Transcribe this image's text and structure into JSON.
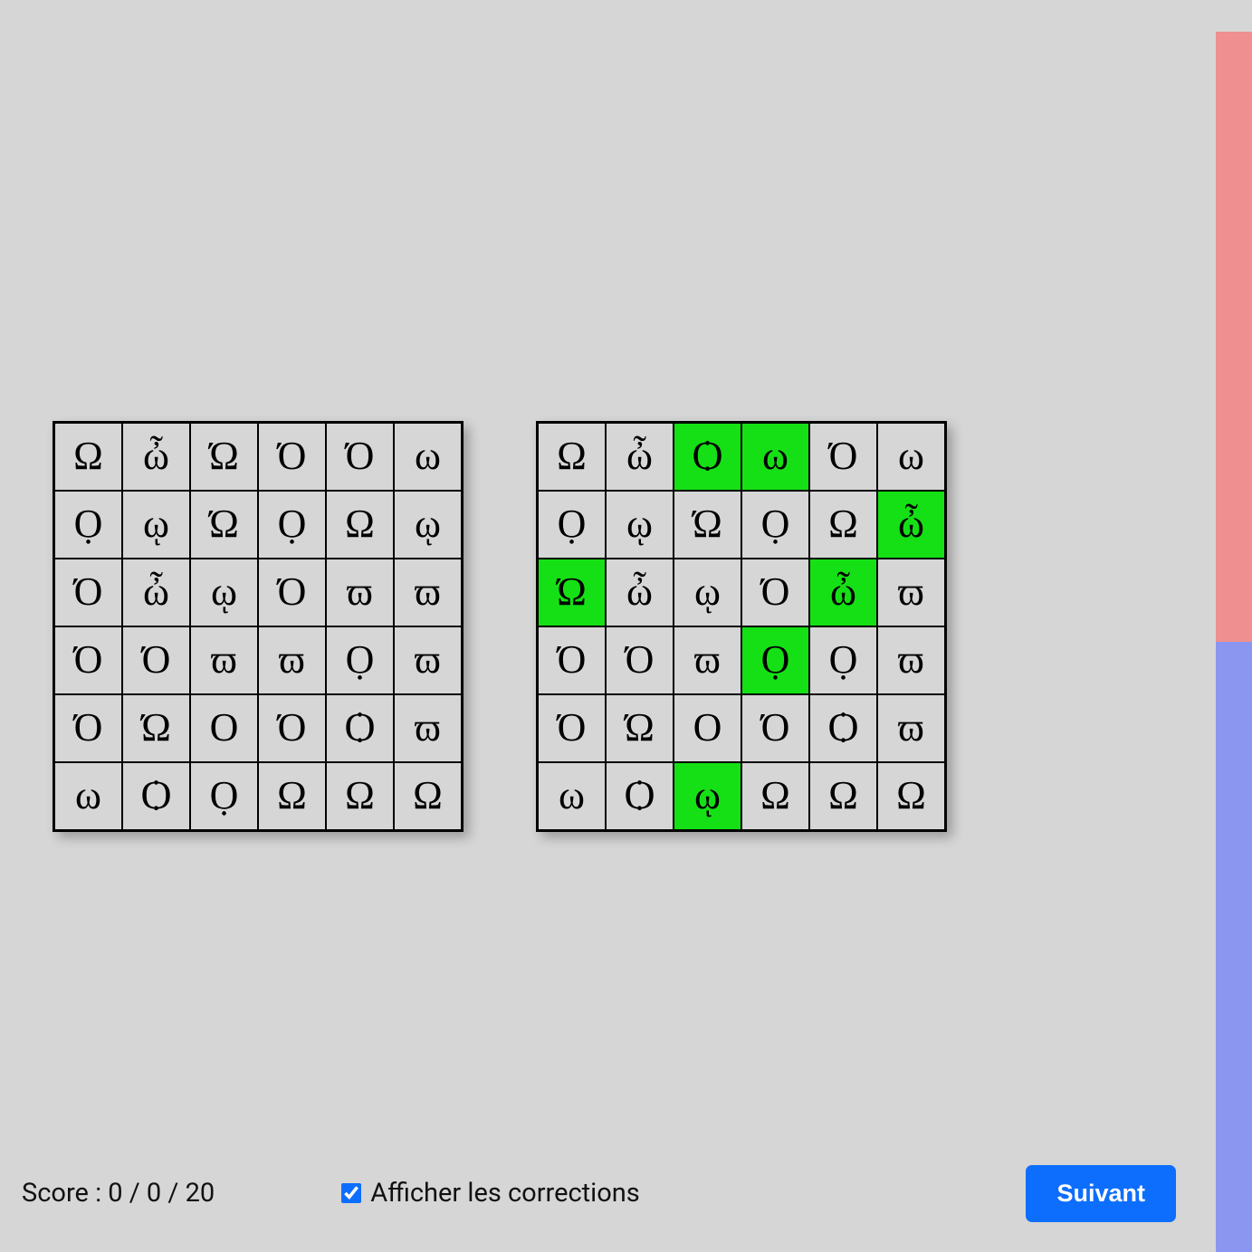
{
  "grid_rows": 6,
  "grid_cols": 6,
  "left_grid": [
    [
      "Ω",
      "ὦ",
      "Ώ",
      "Ό",
      "Ό",
      "ω"
    ],
    [
      "Ọ",
      "ῳ",
      "Ώ",
      "Ọ",
      "Ω",
      "ῳ"
    ],
    [
      "Ό",
      "ὦ",
      "ῳ",
      "Ό",
      "ϖ",
      "ϖ"
    ],
    [
      "Ό",
      "Ό",
      "ϖ",
      "ϖ",
      "Ọ",
      "ϖ"
    ],
    [
      "Ό",
      "Ώ",
      "Ο",
      "Ό",
      "Ѻ",
      "ϖ"
    ],
    [
      "ω",
      "Ѻ",
      "Ọ",
      "Ω",
      "Ω",
      "Ω"
    ]
  ],
  "right_grid": [
    [
      "Ω",
      "ὦ",
      "Ѻ",
      "ω",
      "Ό",
      "ω"
    ],
    [
      "Ọ",
      "ῳ",
      "Ώ",
      "Ọ",
      "Ω",
      "ὦ"
    ],
    [
      "Ώ",
      "ὦ",
      "ῳ",
      "Ό",
      "ὦ",
      "ϖ"
    ],
    [
      "Ό",
      "Ό",
      "ϖ",
      "Ọ",
      "Ọ",
      "ϖ"
    ],
    [
      "Ό",
      "Ώ",
      "Ο",
      "Ό",
      "Ѻ",
      "ϖ"
    ],
    [
      "ω",
      "Ѻ",
      "ῳ",
      "Ω",
      "Ω",
      "Ω"
    ]
  ],
  "highlights_right": [
    [
      0,
      2
    ],
    [
      0,
      3
    ],
    [
      1,
      5
    ],
    [
      2,
      0
    ],
    [
      2,
      4
    ],
    [
      3,
      3
    ],
    [
      5,
      2
    ]
  ],
  "footer": {
    "score_label": "Score : 0 / 0 / 20",
    "corrections_label": "Afficher les corrections",
    "corrections_checked": true,
    "next_label": "Suivant"
  },
  "bar_colors": {
    "top": "#ef8f8f",
    "bottom": "#8a96ef"
  }
}
